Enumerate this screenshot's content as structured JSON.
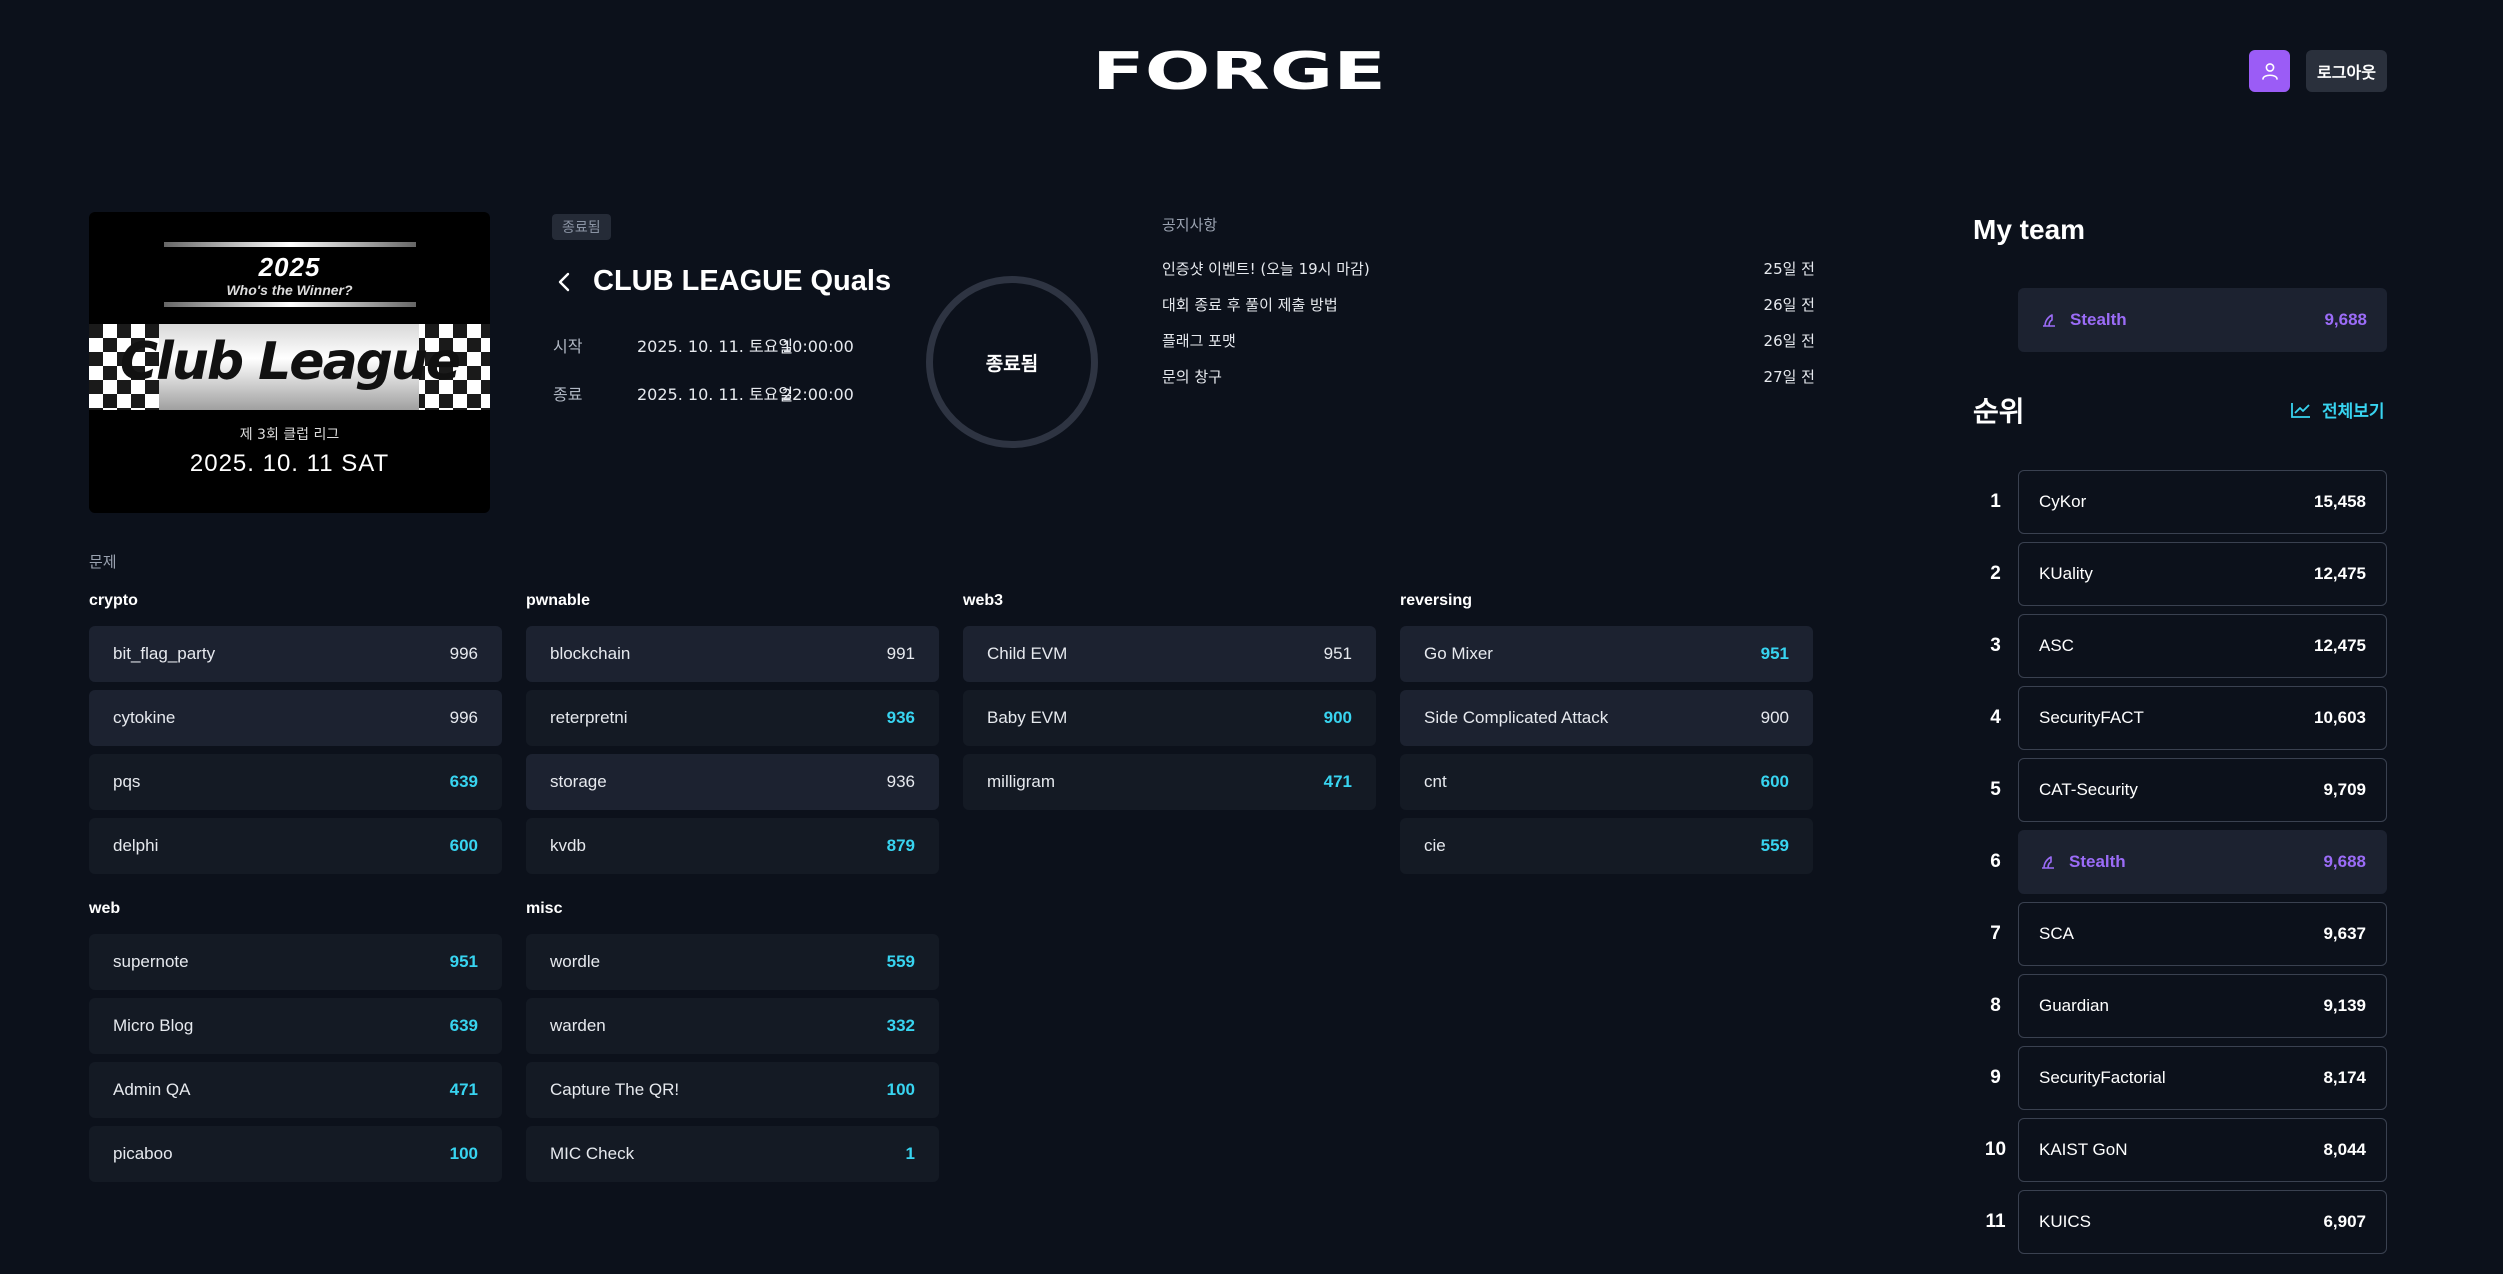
{
  "header": {
    "logo_text": "FORGE",
    "logout_label": "로그아웃"
  },
  "poster": {
    "year": "2025",
    "subtitle": "Who's the Winner?",
    "title": "Club League",
    "caption": "제 3회 클럽 리그",
    "date": "2025. 10. 11 SAT"
  },
  "contest": {
    "status_tag": "종료됨",
    "title": "CLUB LEAGUE Quals",
    "start_label": "시작",
    "start_date": "2025. 10. 11. 토요일",
    "start_time": "10:00:00",
    "end_label": "종료",
    "end_date": "2025. 10. 11. 토요일",
    "end_time": "22:00:00",
    "ring_status": "종료됨"
  },
  "notices": {
    "title": "공지사항",
    "items": [
      {
        "text": "인증샷 이벤트! (오늘 19시 마감)",
        "ago": "25일 전"
      },
      {
        "text": "대회 종료 후 풀이 제출 방법",
        "ago": "26일 전"
      },
      {
        "text": "플래그 포맷",
        "ago": "26일 전"
      },
      {
        "text": "문의 창구",
        "ago": "27일 전"
      }
    ]
  },
  "problems": {
    "label": "문제",
    "categories": [
      {
        "name": "crypto",
        "items": [
          {
            "name": "bit_flag_party",
            "score": "996",
            "highlight": false
          },
          {
            "name": "cytokine",
            "score": "996",
            "highlight": false
          },
          {
            "name": "pqs",
            "score": "639",
            "highlight": true
          },
          {
            "name": "delphi",
            "score": "600",
            "highlight": true
          }
        ]
      },
      {
        "name": "pwnable",
        "items": [
          {
            "name": "blockchain",
            "score": "991",
            "highlight": false
          },
          {
            "name": "reterpretni",
            "score": "936",
            "highlight": true
          },
          {
            "name": "storage",
            "score": "936",
            "highlight": false
          },
          {
            "name": "kvdb",
            "score": "879",
            "highlight": true
          }
        ]
      },
      {
        "name": "web3",
        "items": [
          {
            "name": "Child EVM",
            "score": "951",
            "highlight": false
          },
          {
            "name": "Baby EVM",
            "score": "900",
            "highlight": true
          },
          {
            "name": "milligram",
            "score": "471",
            "highlight": true
          }
        ]
      },
      {
        "name": "reversing",
        "items": [
          {
            "name": "Go Mixer",
            "score": "951",
            "highlight": true
          },
          {
            "name": "Side Complicated Attack",
            "score": "900",
            "highlight": false
          },
          {
            "name": "cnt",
            "score": "600",
            "highlight": true
          },
          {
            "name": "cie",
            "score": "559",
            "highlight": true
          }
        ]
      },
      {
        "name": "web",
        "items": [
          {
            "name": "supernote",
            "score": "951",
            "highlight": true
          },
          {
            "name": "Micro Blog",
            "score": "639",
            "highlight": true
          },
          {
            "name": "Admin QA",
            "score": "471",
            "highlight": true
          },
          {
            "name": "picaboo",
            "score": "100",
            "highlight": true
          }
        ]
      },
      {
        "name": "misc",
        "items": [
          {
            "name": "wordle",
            "score": "559",
            "highlight": true
          },
          {
            "name": "warden",
            "score": "332",
            "highlight": true
          },
          {
            "name": "Capture The QR!",
            "score": "100",
            "highlight": true
          },
          {
            "name": "MIC Check",
            "score": "1",
            "highlight": true
          }
        ]
      }
    ]
  },
  "sidebar": {
    "myteam_title": "My team",
    "myteam": {
      "name": "Stealth",
      "score": "9,688"
    },
    "ranking_title": "순위",
    "view_all": "전체보기",
    "ranking": [
      {
        "rank": "1",
        "name": "CyKor",
        "score": "15,458",
        "mine": false
      },
      {
        "rank": "2",
        "name": "KUality",
        "score": "12,475",
        "mine": false
      },
      {
        "rank": "3",
        "name": "ASC",
        "score": "12,475",
        "mine": false
      },
      {
        "rank": "4",
        "name": "SecurityFACT",
        "score": "10,603",
        "mine": false
      },
      {
        "rank": "5",
        "name": "CAT-Security",
        "score": "9,709",
        "mine": false
      },
      {
        "rank": "6",
        "name": "Stealth",
        "score": "9,688",
        "mine": true
      },
      {
        "rank": "7",
        "name": "SCA",
        "score": "9,637",
        "mine": false
      },
      {
        "rank": "8",
        "name": "Guardian",
        "score": "9,139",
        "mine": false
      },
      {
        "rank": "9",
        "name": "SecurityFactorial",
        "score": "8,174",
        "mine": false
      },
      {
        "rank": "10",
        "name": "KAIST GoN",
        "score": "8,044",
        "mine": false
      },
      {
        "rank": "11",
        "name": "KUICS",
        "score": "6,907",
        "mine": false
      }
    ]
  },
  "colors": {
    "background": "#0c111b",
    "accent_cyan": "#38d4f0",
    "accent_purple": "#9b5cf6"
  }
}
